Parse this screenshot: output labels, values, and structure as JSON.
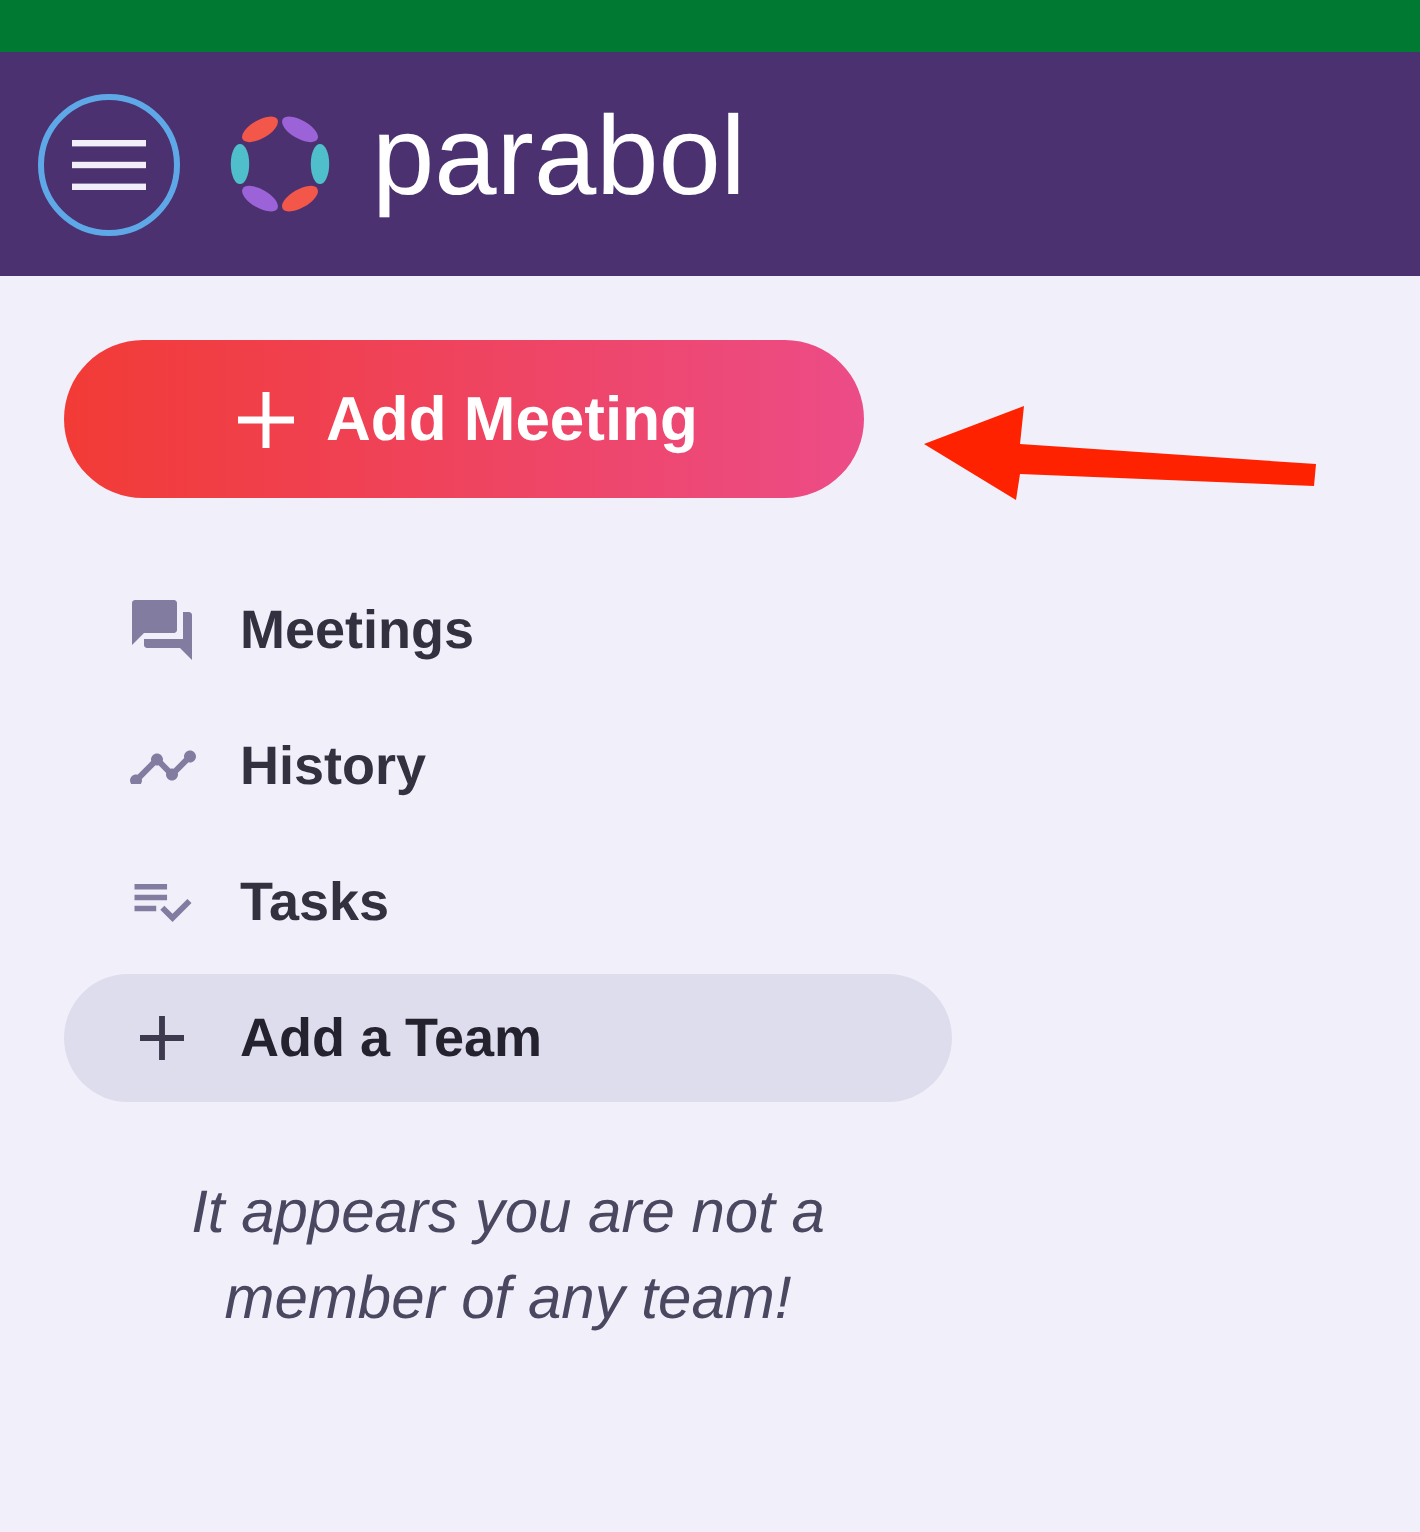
{
  "header": {
    "brand": "parabol"
  },
  "add_meeting_button": {
    "label": "Add Meeting"
  },
  "nav": {
    "items": [
      {
        "label": "Meetings",
        "highlighted": false
      },
      {
        "label": "History",
        "highlighted": false
      },
      {
        "label": "Tasks",
        "highlighted": false
      },
      {
        "label": "Add a Team",
        "highlighted": true
      }
    ]
  },
  "empty_message": "It appears you are not a member of any team!"
}
